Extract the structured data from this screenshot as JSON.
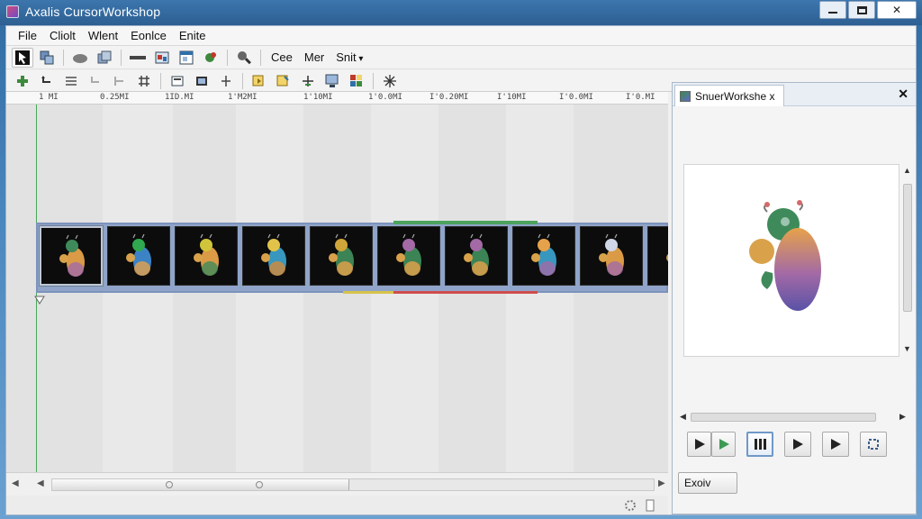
{
  "window": {
    "title": "Axalis CursorWorkshop",
    "icon": "app-icon",
    "controls": [
      "minimize",
      "maximize",
      "close"
    ],
    "close_label": "✕"
  },
  "menu": [
    {
      "label": "File"
    },
    {
      "label": "Cliolt"
    },
    {
      "label": "Wlent"
    },
    {
      "label": "Eonlce"
    },
    {
      "label": "Enite"
    }
  ],
  "toolbar1": {
    "text_items": [
      {
        "label": "Cee"
      },
      {
        "label": "Mer"
      },
      {
        "label": "Snit"
      }
    ]
  },
  "ruler": {
    "labels": [
      "1 MI",
      "0.25MI",
      "1ID.MI",
      "1'M2MI",
      "1'10MI",
      "1'0.0MI",
      "I'0.20MI",
      "I'10MI",
      "I'0.0MI",
      "I'0.MI"
    ]
  },
  "timeline": {
    "frame_count": 10,
    "selected_frame": 1,
    "playhead_label": "",
    "colors": {
      "film": "#8fa4c8",
      "range_green": "#4da35e",
      "range_red": "#cf4d4d"
    }
  },
  "preview": {
    "tab_label": "SnuerWorkshe x",
    "close_label": "✕",
    "export_label": "Exoiv"
  },
  "transport": [
    {
      "name": "play",
      "icon": "play-icon"
    },
    {
      "name": "play-green",
      "icon": "play-green-icon"
    },
    {
      "name": "pause",
      "icon": "pause-icon"
    },
    {
      "name": "step-forward",
      "icon": "play-icon"
    },
    {
      "name": "next",
      "icon": "play-icon"
    },
    {
      "name": "loop",
      "icon": "loop-icon"
    }
  ]
}
